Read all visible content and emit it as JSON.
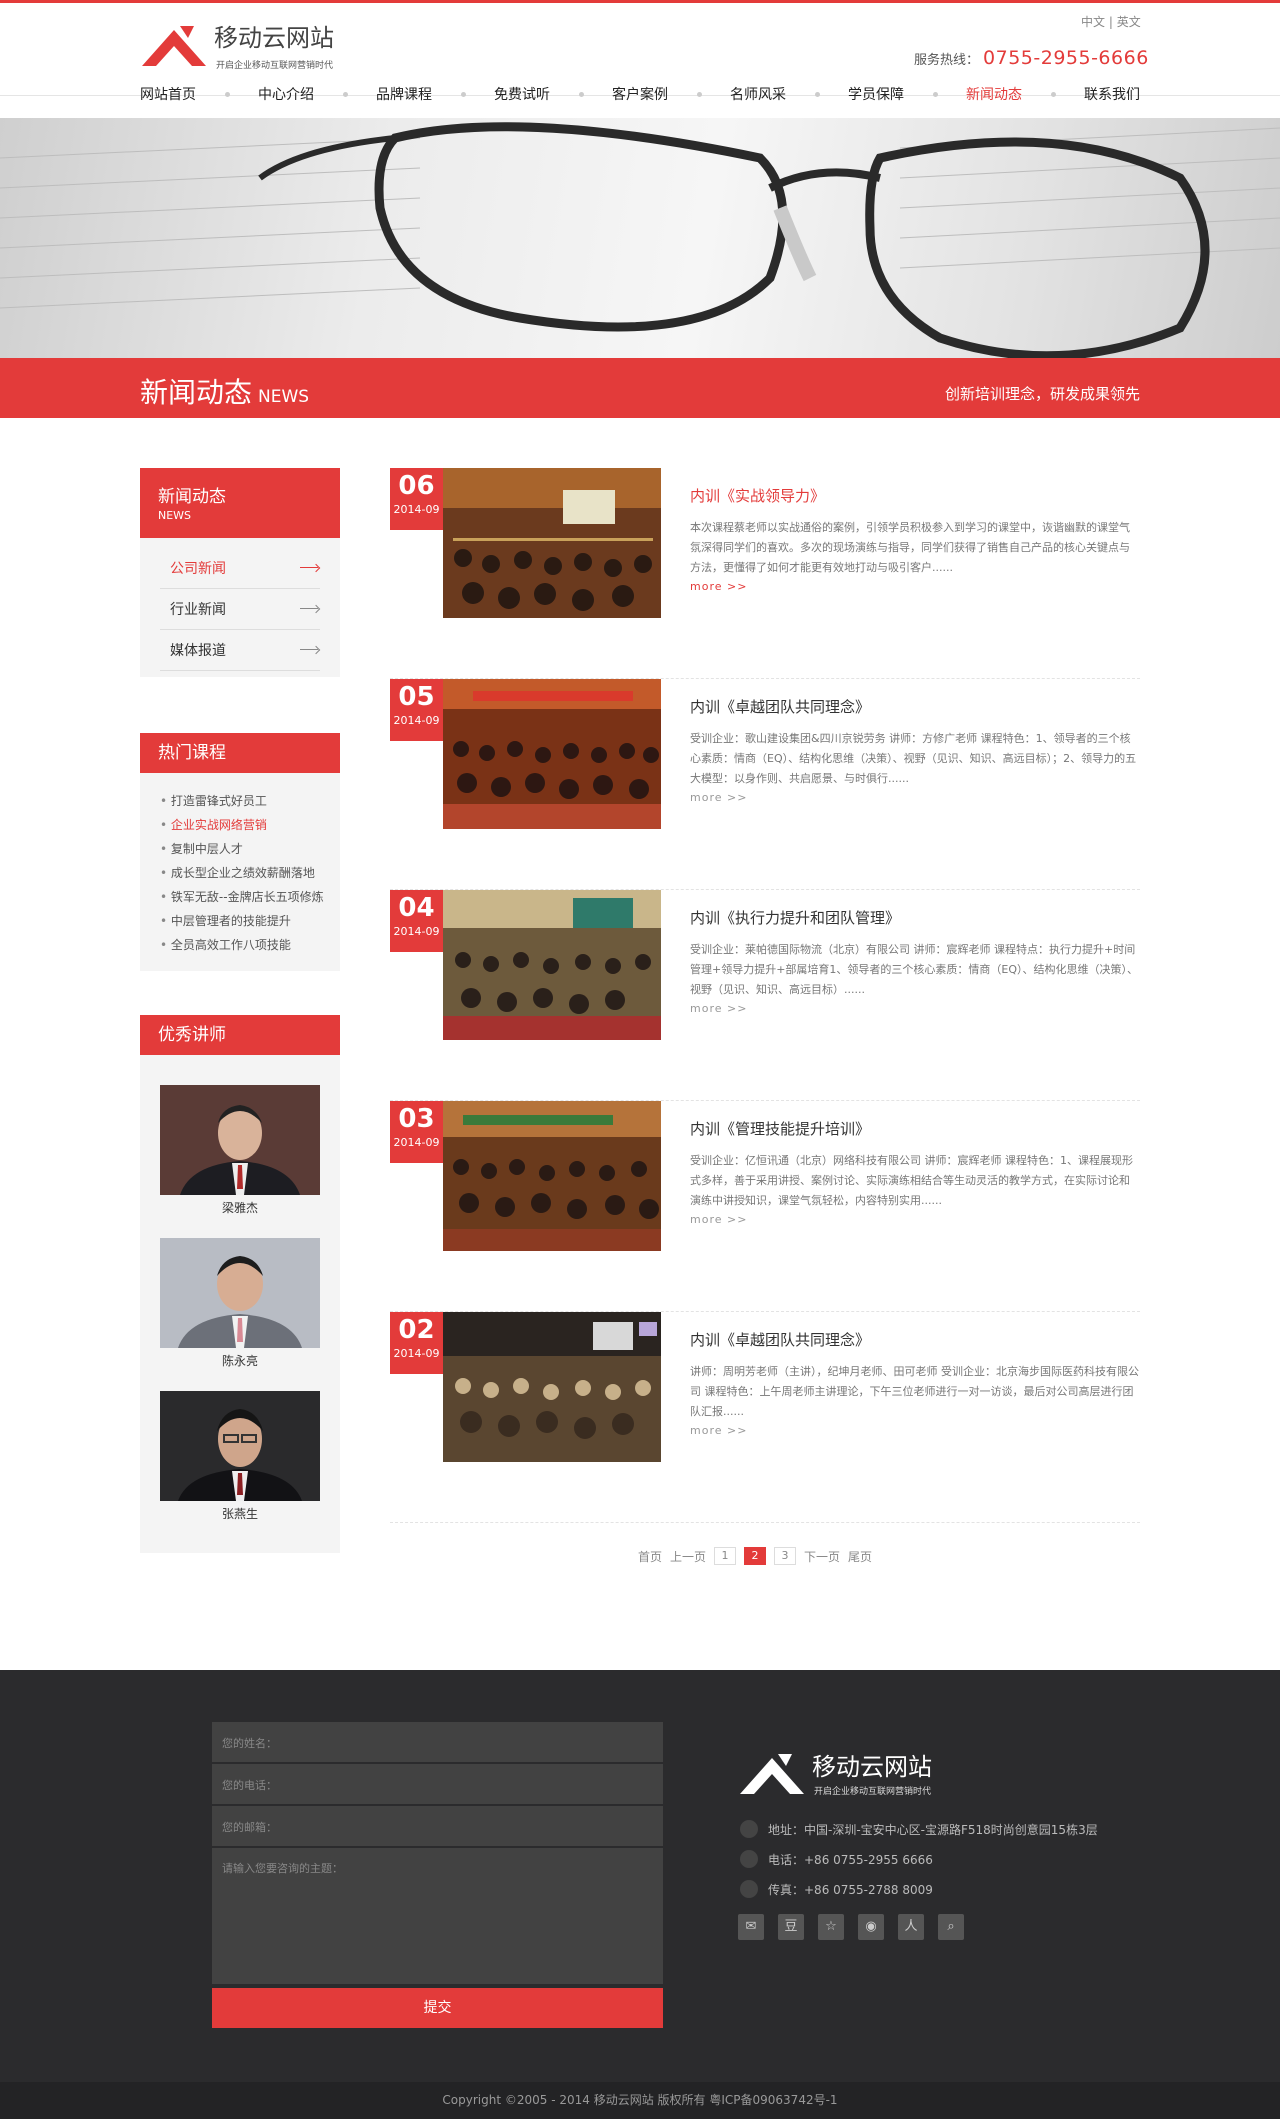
{
  "header": {
    "logo_title": "移动云网站",
    "logo_sub": "开启企业移动互联网营销时代",
    "lang_cn": "中文",
    "lang_sep": "|",
    "lang_en": "英文",
    "hotline_label": "服务热线：",
    "hotline_number": "0755-2955-6666"
  },
  "nav": [
    "网站首页",
    "中心介绍",
    "品牌课程",
    "免费试听",
    "客户案例",
    "名师风采",
    "学员保障",
    "新闻动态",
    "联系我们"
  ],
  "nav_active": "新闻动态",
  "banner_bar": {
    "title": "新闻动态",
    "title_en": "NEWS",
    "slogan": "创新培训理念，研发成果领先"
  },
  "sidebar": {
    "head_title": "新闻动态",
    "head_en": "NEWS",
    "items": [
      {
        "label": "公司新闻",
        "active": true
      },
      {
        "label": "行业新闻",
        "active": false
      },
      {
        "label": "媒体报道",
        "active": false
      }
    ],
    "hot_title": "热门课程",
    "hot_items": [
      "打造雷锋式好员工",
      "企业实战网络营销",
      "复制中层人才",
      "成长型企业之绩效薪酬落地",
      "铁军无敌--金牌店长五项修炼",
      "中层管理者的技能提升",
      "全员高效工作八项技能"
    ],
    "hot_active_index": 1,
    "teacher_title": "优秀讲师",
    "teachers": [
      "梁雅杰",
      "陈永亮",
      "张燕生"
    ]
  },
  "news": [
    {
      "day": "06",
      "ym": "2014-09",
      "title": "内训《实战领导力》",
      "text": "本次课程蔡老师以实战通俗的案例，引领学员积极参入到学习的课堂中，诙谐幽默的课堂气氛深得同学们的喜欢。多次的现场演练与指导，同学们获得了销售自己产品的核心关键点与方法，更懂得了如何才能更有效地打动与吸引客户......",
      "more": "more >>",
      "active": true
    },
    {
      "day": "05",
      "ym": "2014-09",
      "title": "内训《卓越团队共同理念》",
      "text": "受训企业：歌山建设集团&四川京锐劳务  讲师：方修广老师  课程特色：1、领导者的三个核心素质：情商（EQ）、结构化思维（决策）、视野（见识、知识、高远目标）；2、领导力的五大模型：以身作则、共启愿景、与时俱行......",
      "more": "more >>",
      "active": false
    },
    {
      "day": "04",
      "ym": "2014-09",
      "title": "内训《执行力提升和团队管理》",
      "text": "受训企业：莱帕德国际物流（北京）有限公司  讲师：宸辉老师   课程特点：执行力提升+时间管理+领导力提升+部属培育1、领导者的三个核心素质：情商（EQ）、结构化思维（决策）、视野（见识、知识、高远目标）......",
      "more": "more >>",
      "active": false
    },
    {
      "day": "03",
      "ym": "2014-09",
      "title": "内训《管理技能提升培训》",
      "text": "受训企业：亿恒讯通（北京）网络科技有限公司  讲师：宸辉老师    课程特色：1、课程展现形式多样，善于采用讲授、案例讨论、实际演练相结合等生动灵活的教学方式，在实际讨论和演练中讲授知识，课堂气氛轻松，内容特别实用......",
      "more": "more >>",
      "active": false
    },
    {
      "day": "02",
      "ym": "2014-09",
      "title": "内训《卓越团队共同理念》",
      "text": "讲师：周明芳老师（主讲），纪坤月老师、田可老师  受训企业：北京海步国际医药科技有限公司  课程特色：上午周老师主讲理论，下午三位老师进行一对一访谈，最后对公司高层进行团队汇报......",
      "more": "more >>",
      "active": false
    }
  ],
  "pager": {
    "first": "首页",
    "prev": "上一页",
    "pages": [
      "1",
      "2",
      "3"
    ],
    "current": "2",
    "next": "下一页",
    "last": "尾页"
  },
  "footer": {
    "name_placeholder": "您的姓名：",
    "phone_placeholder": "您的电话：",
    "email_placeholder": "您的邮箱：",
    "message_placeholder": "请输入您要咨询的主题：",
    "submit": "提交",
    "logo_title": "移动云网站",
    "logo_sub": "开启企业移动互联网营销时代",
    "address": "地址：中国-深圳-宝安中心区-宝源路F518时尚创意园15栋3层",
    "tel": "电话：+86 0755-2955 6666",
    "fax": "传真：+86 0755-2788 8009",
    "social": [
      "wechat-icon",
      "douban-icon",
      "star-icon",
      "weibo-icon",
      "renren-icon",
      "search-icon"
    ],
    "copyright": "Copyright ©2005 - 2014  移动云网站 版权所有      粤ICP备09063742号-1"
  },
  "colors": {
    "accent": "#e33b3a",
    "footer_bg": "#2b2b2d"
  }
}
